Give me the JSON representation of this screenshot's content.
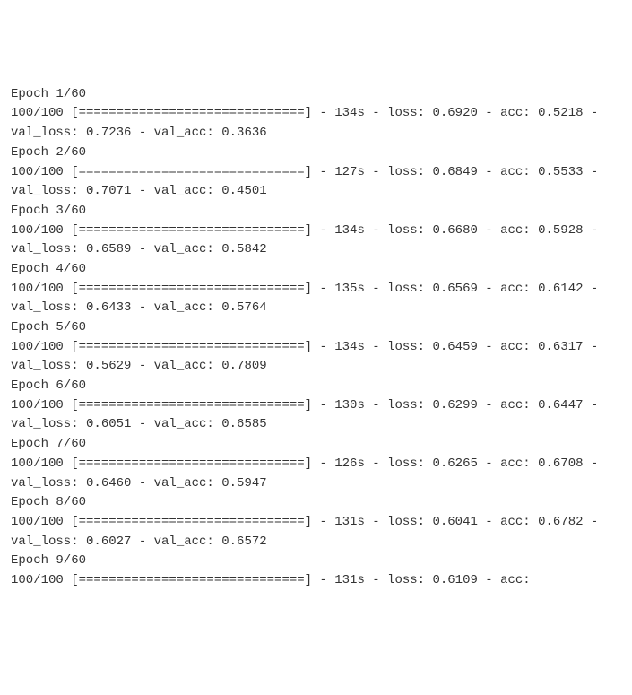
{
  "training": {
    "total_epochs": 60,
    "steps_label": "100/100",
    "progress_bar": "[==============================]",
    "epochs": [
      {
        "epoch": 1,
        "time": "134s",
        "loss": "0.6920",
        "acc": "0.5218",
        "val_loss": "0.7236",
        "val_acc": "0.3636"
      },
      {
        "epoch": 2,
        "time": "127s",
        "loss": "0.6849",
        "acc": "0.5533",
        "val_loss": "0.7071",
        "val_acc": "0.4501"
      },
      {
        "epoch": 3,
        "time": "134s",
        "loss": "0.6680",
        "acc": "0.5928",
        "val_loss": "0.6589",
        "val_acc": "0.5842"
      },
      {
        "epoch": 4,
        "time": "135s",
        "loss": "0.6569",
        "acc": "0.6142",
        "val_loss": "0.6433",
        "val_acc": "0.5764"
      },
      {
        "epoch": 5,
        "time": "134s",
        "loss": "0.6459",
        "acc": "0.6317",
        "val_loss": "0.5629",
        "val_acc": "0.7809"
      },
      {
        "epoch": 6,
        "time": "130s",
        "loss": "0.6299",
        "acc": "0.6447",
        "val_loss": "0.6051",
        "val_acc": "0.6585"
      },
      {
        "epoch": 7,
        "time": "126s",
        "loss": "0.6265",
        "acc": "0.6708",
        "val_loss": "0.6460",
        "val_acc": "0.5947"
      },
      {
        "epoch": 8,
        "time": "131s",
        "loss": "0.6041",
        "acc": "0.6782",
        "val_loss": "0.6027",
        "val_acc": "0.6572"
      },
      {
        "epoch": 9,
        "time": "131s",
        "loss": "0.6109",
        "acc": null,
        "val_loss": null,
        "val_acc": null,
        "partial": true
      }
    ]
  },
  "labels": {
    "epoch_prefix": "Epoch ",
    "loss_label": "loss:",
    "acc_label": "acc:",
    "val_loss_label": "val_loss:",
    "val_acc_label": "val_acc:"
  }
}
